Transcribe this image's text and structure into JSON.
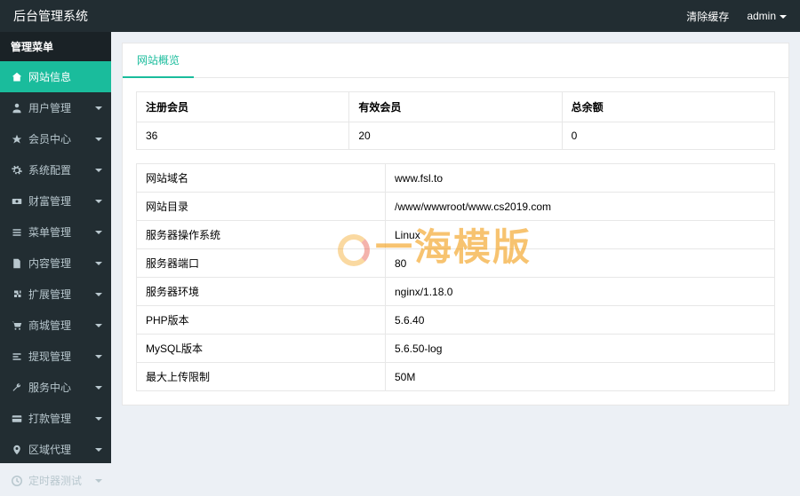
{
  "header": {
    "brand": "后台管理系统",
    "clear_cache": "清除缓存",
    "user": "admin"
  },
  "sidebar": {
    "title": "管理菜单",
    "items": [
      {
        "label": "网站信息",
        "icon": "home-icon",
        "active": true,
        "expandable": false
      },
      {
        "label": "用户管理",
        "icon": "users-icon",
        "active": false,
        "expandable": true
      },
      {
        "label": "会员中心",
        "icon": "star-icon",
        "active": false,
        "expandable": true
      },
      {
        "label": "系统配置",
        "icon": "cogs-icon",
        "active": false,
        "expandable": true
      },
      {
        "label": "财富管理",
        "icon": "money-icon",
        "active": false,
        "expandable": true
      },
      {
        "label": "菜单管理",
        "icon": "list-icon",
        "active": false,
        "expandable": true
      },
      {
        "label": "内容管理",
        "icon": "file-icon",
        "active": false,
        "expandable": true
      },
      {
        "label": "扩展管理",
        "icon": "puzzle-icon",
        "active": false,
        "expandable": true
      },
      {
        "label": "商城管理",
        "icon": "cart-icon",
        "active": false,
        "expandable": true
      },
      {
        "label": "提现管理",
        "icon": "withdraw-icon",
        "active": false,
        "expandable": true
      },
      {
        "label": "服务中心",
        "icon": "wrench-icon",
        "active": false,
        "expandable": true
      },
      {
        "label": "打款管理",
        "icon": "credit-icon",
        "active": false,
        "expandable": true
      },
      {
        "label": "区域代理",
        "icon": "map-icon",
        "active": false,
        "expandable": true
      },
      {
        "label": "定时器测试",
        "icon": "clock-icon",
        "active": false,
        "expandable": true
      }
    ]
  },
  "main": {
    "tab_label": "网站概览",
    "stats": {
      "headers": [
        "注册会员",
        "有效会员",
        "总余额"
      ],
      "values": [
        "36",
        "20",
        "0"
      ]
    },
    "info_rows": [
      {
        "label": "网站域名",
        "value": "www.fsl.to"
      },
      {
        "label": "网站目录",
        "value": "/www/wwwroot/www.cs2019.com"
      },
      {
        "label": "服务器操作系统",
        "value": "Linux"
      },
      {
        "label": "服务器端口",
        "value": "80"
      },
      {
        "label": "服务器环境",
        "value": "nginx/1.18.0"
      },
      {
        "label": "PHP版本",
        "value": "5.6.40"
      },
      {
        "label": "MySQL版本",
        "value": "5.6.50-log"
      },
      {
        "label": "最大上传限制",
        "value": "50M"
      }
    ]
  },
  "watermark": "一海模版"
}
